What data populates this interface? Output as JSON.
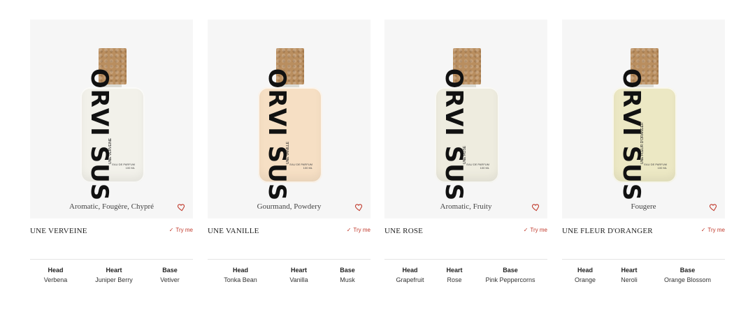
{
  "products": [
    {
      "name": "UNE VERVEINE",
      "tagline": "Aromatic, Fougère, Chypré",
      "try_label": "Try me",
      "bottle": {
        "brand": "ORVI SUS",
        "label_name": "UNE VERVEINE",
        "edp": "EAU DE PARFUM",
        "volume": "100 ML",
        "tint": "#f2f1ea"
      },
      "notes": {
        "head_label": "Head",
        "head": "Verbena",
        "heart_label": "Heart",
        "heart": "Juniper Berry",
        "base_label": "Base",
        "base": "Vetiver"
      }
    },
    {
      "name": "UNE VANILLE",
      "tagline": "Gourmand, Powdery",
      "try_label": "Try me",
      "bottle": {
        "brand": "ORVI SUS",
        "label_name": "UNE VANILLE",
        "edp": "EAU DE PARFUM",
        "volume": "100 ML",
        "tint": "#f6dfc4"
      },
      "notes": {
        "head_label": "Head",
        "head": "Tonka Bean",
        "heart_label": "Heart",
        "heart": "Vanilla",
        "base_label": "Base",
        "base": "Musk"
      }
    },
    {
      "name": "UNE ROSE",
      "tagline": "Aromatic, Fruity",
      "try_label": "Try me",
      "bottle": {
        "brand": "ORVI SUS",
        "label_name": "UNE ROSE",
        "edp": "EAU DE PARFUM",
        "volume": "100 ML",
        "tint": "#eeecdf"
      },
      "notes": {
        "head_label": "Head",
        "head": "Grapefruit",
        "heart_label": "Heart",
        "heart": "Rose",
        "base_label": "Base",
        "base": "Pink Peppercorns"
      }
    },
    {
      "name": "UNE FLEUR D'ORANGER",
      "tagline": "Fougere",
      "try_label": "Try me",
      "bottle": {
        "brand": "ORVI SUS",
        "label_name": "UNE FLEUR D'ORANGER",
        "edp": "EAU DE PARFUM",
        "volume": "100 ML",
        "tint": "#ece8c4"
      },
      "notes": {
        "head_label": "Head",
        "head": "Orange",
        "heart_label": "Heart",
        "heart": "Neroli",
        "base_label": "Base",
        "base": "Orange Blossom"
      }
    }
  ],
  "icons": {
    "wishlist": "heart-outline-icon",
    "try": "checkmark-icon"
  },
  "colors": {
    "accent": "#c0392b",
    "card_bg": "#f6f6f6"
  }
}
